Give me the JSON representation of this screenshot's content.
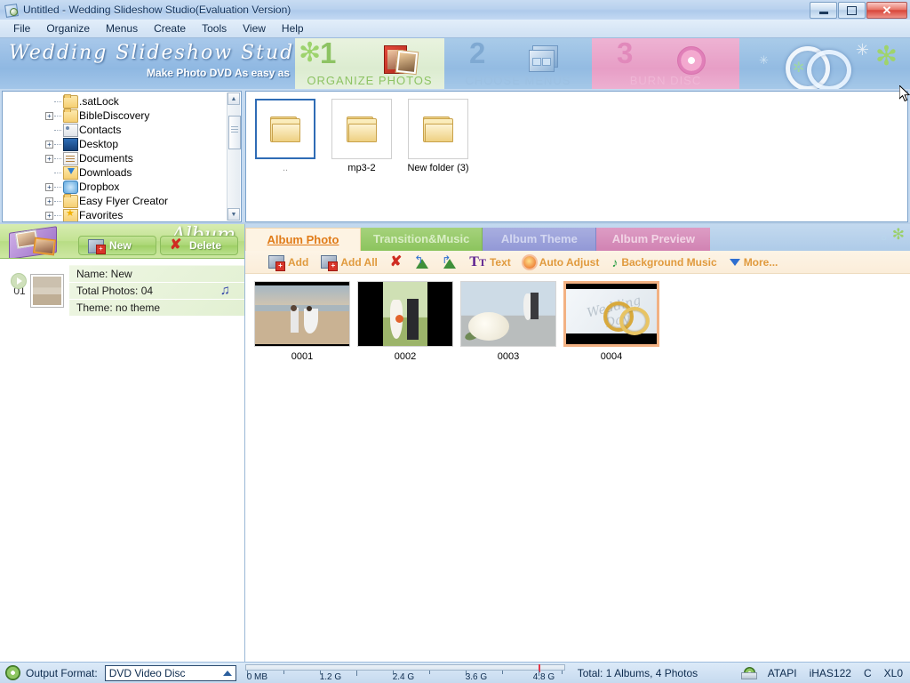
{
  "window": {
    "title": "Untitled - Wedding Slideshow Studio(Evaluation Version)",
    "app_icon": "app-icon",
    "minimize": "–",
    "maximize": "❐",
    "close": "✕"
  },
  "menubar": {
    "items": [
      {
        "label": "File"
      },
      {
        "label": "Organize"
      },
      {
        "label": "Menus"
      },
      {
        "label": "Create"
      },
      {
        "label": "Tools"
      },
      {
        "label": "View"
      },
      {
        "label": "Help"
      }
    ]
  },
  "banner": {
    "brand": "Wedding Slideshow Studio",
    "tagline": "Make Photo DVD As easy as",
    "steps": [
      {
        "number": "1",
        "label": "ORGANIZE PHOTOS",
        "icon": "photos-icon",
        "active": true
      },
      {
        "number": "2",
        "label": "CHOOSE MENUS",
        "icon": "menus-icon",
        "active": false
      },
      {
        "number": "3",
        "label": "BURN  DISC",
        "icon": "disc-icon",
        "active": false
      }
    ]
  },
  "tree": {
    "items": [
      {
        "label": ".satLock",
        "icon": "folder-icon",
        "expandable": false
      },
      {
        "label": "BibleDiscovery",
        "icon": "folder-icon",
        "expandable": true
      },
      {
        "label": "Contacts",
        "icon": "contacts-icon",
        "expandable": false
      },
      {
        "label": "Desktop",
        "icon": "desktop-icon",
        "expandable": true
      },
      {
        "label": "Documents",
        "icon": "documents-icon",
        "expandable": true
      },
      {
        "label": "Downloads",
        "icon": "downloads-icon",
        "expandable": false
      },
      {
        "label": "Dropbox",
        "icon": "dropbox-icon",
        "expandable": true
      },
      {
        "label": "Easy Flyer Creator",
        "icon": "folder-icon",
        "expandable": true
      },
      {
        "label": "Favorites",
        "icon": "favorites-icon",
        "expandable": true
      }
    ],
    "expander_plus": "+"
  },
  "folders": {
    "items": [
      {
        "label": "..",
        "icon": "folder-icon",
        "selected": true
      },
      {
        "label": "mp3-2",
        "icon": "folder-icon",
        "selected": false
      },
      {
        "label": "New folder (3)",
        "icon": "folder-icon",
        "selected": false
      }
    ]
  },
  "album": {
    "heading": "Album",
    "new_label": "New",
    "delete_label": "Delete",
    "items": [
      {
        "index": "01",
        "name": "Name: New",
        "total": "Total Photos: 04",
        "theme": "Theme: no theme",
        "music_icon": "music-note-icon"
      }
    ]
  },
  "tabs": [
    {
      "label": "Album Photo",
      "active": true
    },
    {
      "label": "Transition&Music",
      "active": false
    },
    {
      "label": "Album Theme",
      "active": false
    },
    {
      "label": "Album Preview",
      "active": false
    }
  ],
  "toolbar": {
    "buttons": [
      {
        "label": "Add",
        "icon": "add-photo-icon"
      },
      {
        "label": "Add All",
        "icon": "add-all-photos-icon"
      },
      {
        "label": "",
        "icon": "delete-x-icon"
      },
      {
        "label": "",
        "icon": "rotate-left-icon"
      },
      {
        "label": "",
        "icon": "rotate-right-icon"
      },
      {
        "label": "Text",
        "icon": "text-tt-icon"
      },
      {
        "label": "Auto Adjust",
        "icon": "auto-adjust-icon"
      },
      {
        "label": "Background Music",
        "icon": "music-note-icon"
      },
      {
        "label": "More...",
        "icon": "chevron-down-icon"
      }
    ]
  },
  "photos": [
    {
      "label": "0001",
      "selected": false,
      "art": "beach-couple"
    },
    {
      "label": "0002",
      "selected": false,
      "art": "garden-couple"
    },
    {
      "label": "0003",
      "selected": false,
      "art": "bouquet"
    },
    {
      "label": "0004",
      "selected": true,
      "art": "wedding-rings"
    }
  ],
  "statusbar": {
    "output_format_label": "Output Format:",
    "output_format_value": "DVD Video Disc",
    "disc_icon": "disc-icon",
    "gauge_ticks": [
      "0 MB",
      "1.2 G",
      "2.4 G",
      "3.6 G",
      "4.8 G"
    ],
    "total": "Total: 1 Albums, 4 Photos",
    "drive_icon": "optical-drive-icon",
    "drive_interface": "ATAPI",
    "drive_model": "iHAS122",
    "drive_letter": "C",
    "drive_extra": "XL0"
  },
  "colors": {
    "accent_orange": "#e07b18",
    "step1_green": "#8dc363",
    "step2_blue": "#7fa9d2",
    "step3_pink": "#e189bb",
    "selection_blue": "#2f6cb5",
    "photo_selected": "#f2b183"
  }
}
